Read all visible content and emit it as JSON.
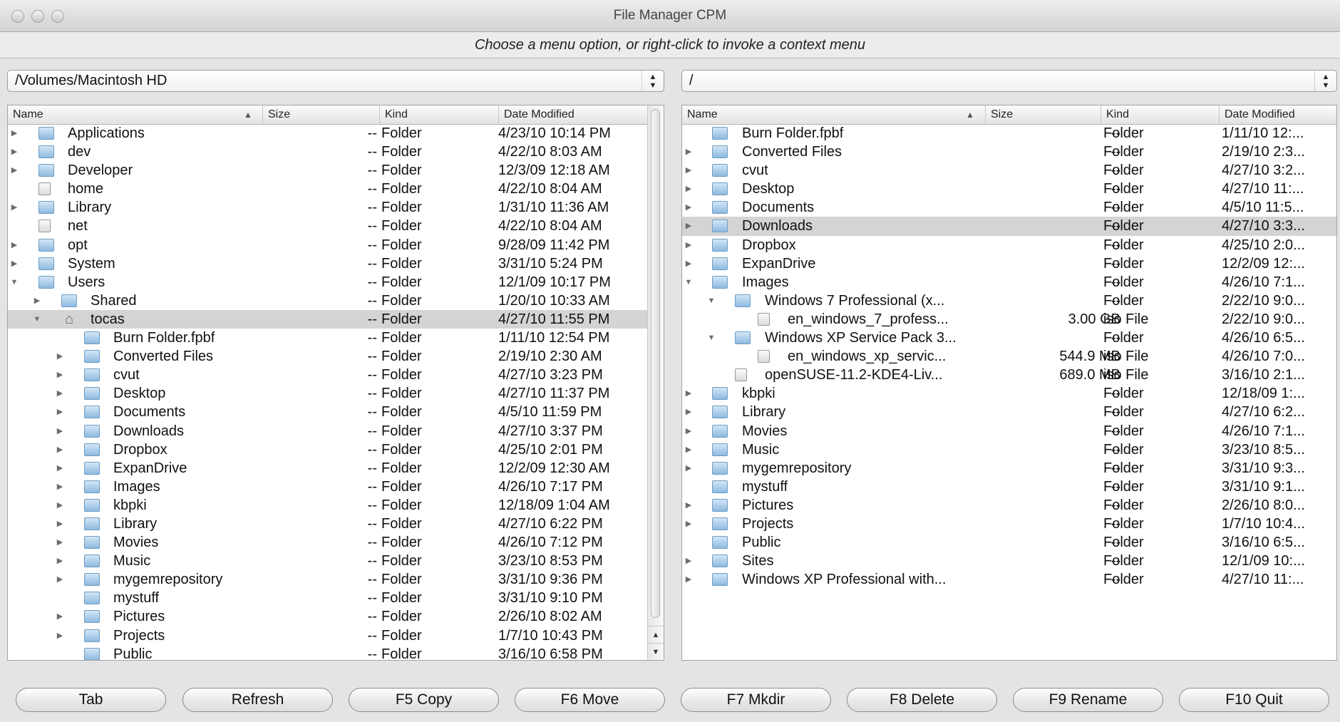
{
  "window": {
    "title": "File Manager CPM",
    "hint": "Choose a menu option, or right-click to invoke a context menu"
  },
  "left": {
    "path": "/Volumes/Macintosh HD",
    "columns": [
      "Name",
      "Size",
      "Kind",
      "Date Modified"
    ],
    "rows": [
      {
        "name": "Applications",
        "size": "--",
        "kind": "Folder",
        "date": "4/23/10 10:14 PM",
        "indent": 0,
        "expander": "closed",
        "icon": "folder"
      },
      {
        "name": "dev",
        "size": "--",
        "kind": "Folder",
        "date": "4/22/10 8:03 AM",
        "indent": 0,
        "expander": "closed",
        "icon": "folder"
      },
      {
        "name": "Developer",
        "size": "--",
        "kind": "Folder",
        "date": "12/3/09 12:18 AM",
        "indent": 0,
        "expander": "closed",
        "icon": "folder"
      },
      {
        "name": "home",
        "size": "--",
        "kind": "Folder",
        "date": "4/22/10 8:04 AM",
        "indent": 0,
        "expander": "none",
        "icon": "generic"
      },
      {
        "name": "Library",
        "size": "--",
        "kind": "Folder",
        "date": "1/31/10 11:36 AM",
        "indent": 0,
        "expander": "closed",
        "icon": "folder"
      },
      {
        "name": "net",
        "size": "--",
        "kind": "Folder",
        "date": "4/22/10 8:04 AM",
        "indent": 0,
        "expander": "none",
        "icon": "generic"
      },
      {
        "name": "opt",
        "size": "--",
        "kind": "Folder",
        "date": "9/28/09 11:42 PM",
        "indent": 0,
        "expander": "closed",
        "icon": "folder"
      },
      {
        "name": "System",
        "size": "--",
        "kind": "Folder",
        "date": "3/31/10 5:24 PM",
        "indent": 0,
        "expander": "closed",
        "icon": "folder"
      },
      {
        "name": "Users",
        "size": "--",
        "kind": "Folder",
        "date": "12/1/09 10:17 PM",
        "indent": 0,
        "expander": "open",
        "icon": "folder"
      },
      {
        "name": "Shared",
        "size": "--",
        "kind": "Folder",
        "date": "1/20/10 10:33 AM",
        "indent": 1,
        "expander": "closed",
        "icon": "folder"
      },
      {
        "name": "tocas",
        "size": "--",
        "kind": "Folder",
        "date": "4/27/10 11:55 PM",
        "indent": 1,
        "expander": "open",
        "icon": "home",
        "selected": true
      },
      {
        "name": "Burn Folder.fpbf",
        "size": "--",
        "kind": "Folder",
        "date": "1/11/10 12:54 PM",
        "indent": 2,
        "expander": "none",
        "icon": "folder"
      },
      {
        "name": "Converted Files",
        "size": "--",
        "kind": "Folder",
        "date": "2/19/10 2:30 AM",
        "indent": 2,
        "expander": "closed",
        "icon": "folder"
      },
      {
        "name": "cvut",
        "size": "--",
        "kind": "Folder",
        "date": "4/27/10 3:23 PM",
        "indent": 2,
        "expander": "closed",
        "icon": "folder"
      },
      {
        "name": "Desktop",
        "size": "--",
        "kind": "Folder",
        "date": "4/27/10 11:37 PM",
        "indent": 2,
        "expander": "closed",
        "icon": "folder"
      },
      {
        "name": "Documents",
        "size": "--",
        "kind": "Folder",
        "date": "4/5/10 11:59 PM",
        "indent": 2,
        "expander": "closed",
        "icon": "folder"
      },
      {
        "name": "Downloads",
        "size": "--",
        "kind": "Folder",
        "date": "4/27/10 3:37 PM",
        "indent": 2,
        "expander": "closed",
        "icon": "folder"
      },
      {
        "name": "Dropbox",
        "size": "--",
        "kind": "Folder",
        "date": "4/25/10 2:01 PM",
        "indent": 2,
        "expander": "closed",
        "icon": "folder"
      },
      {
        "name": "ExpanDrive",
        "size": "--",
        "kind": "Folder",
        "date": "12/2/09 12:30 AM",
        "indent": 2,
        "expander": "closed",
        "icon": "folder"
      },
      {
        "name": "Images",
        "size": "--",
        "kind": "Folder",
        "date": "4/26/10 7:17 PM",
        "indent": 2,
        "expander": "closed",
        "icon": "folder"
      },
      {
        "name": "kbpki",
        "size": "--",
        "kind": "Folder",
        "date": "12/18/09 1:04 AM",
        "indent": 2,
        "expander": "closed",
        "icon": "folder"
      },
      {
        "name": "Library",
        "size": "--",
        "kind": "Folder",
        "date": "4/27/10 6:22 PM",
        "indent": 2,
        "expander": "closed",
        "icon": "folder"
      },
      {
        "name": "Movies",
        "size": "--",
        "kind": "Folder",
        "date": "4/26/10 7:12 PM",
        "indent": 2,
        "expander": "closed",
        "icon": "folder"
      },
      {
        "name": "Music",
        "size": "--",
        "kind": "Folder",
        "date": "3/23/10 8:53 PM",
        "indent": 2,
        "expander": "closed",
        "icon": "folder"
      },
      {
        "name": "mygemrepository",
        "size": "--",
        "kind": "Folder",
        "date": "3/31/10 9:36 PM",
        "indent": 2,
        "expander": "closed",
        "icon": "folder"
      },
      {
        "name": "mystuff",
        "size": "--",
        "kind": "Folder",
        "date": "3/31/10 9:10 PM",
        "indent": 2,
        "expander": "none",
        "icon": "folder"
      },
      {
        "name": "Pictures",
        "size": "--",
        "kind": "Folder",
        "date": "2/26/10 8:02 AM",
        "indent": 2,
        "expander": "closed",
        "icon": "folder"
      },
      {
        "name": "Projects",
        "size": "--",
        "kind": "Folder",
        "date": "1/7/10 10:43 PM",
        "indent": 2,
        "expander": "closed",
        "icon": "folder"
      },
      {
        "name": "Public",
        "size": "--",
        "kind": "Folder",
        "date": "3/16/10 6:58 PM",
        "indent": 2,
        "expander": "none",
        "icon": "folder"
      }
    ]
  },
  "right": {
    "path": "/",
    "columns": [
      "Name",
      "Size",
      "Kind",
      "Date Modified"
    ],
    "rows": [
      {
        "name": "Burn Folder.fpbf",
        "size": "--",
        "kind": "Folder",
        "date": "1/11/10 12:...",
        "indent": 0,
        "expander": "none",
        "icon": "folder"
      },
      {
        "name": "Converted Files",
        "size": "--",
        "kind": "Folder",
        "date": "2/19/10 2:3...",
        "indent": 0,
        "expander": "closed",
        "icon": "folder"
      },
      {
        "name": "cvut",
        "size": "--",
        "kind": "Folder",
        "date": "4/27/10 3:2...",
        "indent": 0,
        "expander": "closed",
        "icon": "folder"
      },
      {
        "name": "Desktop",
        "size": "--",
        "kind": "Folder",
        "date": "4/27/10 11:...",
        "indent": 0,
        "expander": "closed",
        "icon": "folder"
      },
      {
        "name": "Documents",
        "size": "--",
        "kind": "Folder",
        "date": "4/5/10 11:5...",
        "indent": 0,
        "expander": "closed",
        "icon": "folder"
      },
      {
        "name": "Downloads",
        "size": "--",
        "kind": "Folder",
        "date": "4/27/10 3:3...",
        "indent": 0,
        "expander": "closed",
        "icon": "folder",
        "selected": true
      },
      {
        "name": "Dropbox",
        "size": "--",
        "kind": "Folder",
        "date": "4/25/10 2:0...",
        "indent": 0,
        "expander": "closed",
        "icon": "folder"
      },
      {
        "name": "ExpanDrive",
        "size": "--",
        "kind": "Folder",
        "date": "12/2/09 12:...",
        "indent": 0,
        "expander": "closed",
        "icon": "folder"
      },
      {
        "name": "Images",
        "size": "--",
        "kind": "Folder",
        "date": "4/26/10 7:1...",
        "indent": 0,
        "expander": "open",
        "icon": "folder"
      },
      {
        "name": "Windows 7 Professional (x...",
        "size": "--",
        "kind": "Folder",
        "date": "2/22/10 9:0...",
        "indent": 1,
        "expander": "open",
        "icon": "folder"
      },
      {
        "name": "en_windows_7_profess...",
        "size": "3.00 GB",
        "kind": "iso File",
        "date": "2/22/10 9:0...",
        "indent": 2,
        "expander": "none",
        "icon": "generic"
      },
      {
        "name": "Windows XP Service Pack 3...",
        "size": "--",
        "kind": "Folder",
        "date": "4/26/10 6:5...",
        "indent": 1,
        "expander": "open",
        "icon": "folder"
      },
      {
        "name": "en_windows_xp_servic...",
        "size": "544.9 MB",
        "kind": "iso File",
        "date": "4/26/10 7:0...",
        "indent": 2,
        "expander": "none",
        "icon": "generic"
      },
      {
        "name": "openSUSE-11.2-KDE4-Liv...",
        "size": "689.0 MB",
        "kind": "iso File",
        "date": "3/16/10 2:1...",
        "indent": 1,
        "expander": "none",
        "icon": "generic"
      },
      {
        "name": "kbpki",
        "size": "--",
        "kind": "Folder",
        "date": "12/18/09 1:...",
        "indent": 0,
        "expander": "closed",
        "icon": "folder"
      },
      {
        "name": "Library",
        "size": "--",
        "kind": "Folder",
        "date": "4/27/10 6:2...",
        "indent": 0,
        "expander": "closed",
        "icon": "folder"
      },
      {
        "name": "Movies",
        "size": "--",
        "kind": "Folder",
        "date": "4/26/10 7:1...",
        "indent": 0,
        "expander": "closed",
        "icon": "folder"
      },
      {
        "name": "Music",
        "size": "--",
        "kind": "Folder",
        "date": "3/23/10 8:5...",
        "indent": 0,
        "expander": "closed",
        "icon": "folder"
      },
      {
        "name": "mygemrepository",
        "size": "--",
        "kind": "Folder",
        "date": "3/31/10 9:3...",
        "indent": 0,
        "expander": "closed",
        "icon": "folder"
      },
      {
        "name": "mystuff",
        "size": "--",
        "kind": "Folder",
        "date": "3/31/10 9:1...",
        "indent": 0,
        "expander": "none",
        "icon": "folder"
      },
      {
        "name": "Pictures",
        "size": "--",
        "kind": "Folder",
        "date": "2/26/10 8:0...",
        "indent": 0,
        "expander": "closed",
        "icon": "folder"
      },
      {
        "name": "Projects",
        "size": "--",
        "kind": "Folder",
        "date": "1/7/10 10:4...",
        "indent": 0,
        "expander": "closed",
        "icon": "folder"
      },
      {
        "name": "Public",
        "size": "--",
        "kind": "Folder",
        "date": "3/16/10 6:5...",
        "indent": 0,
        "expander": "none",
        "icon": "folder"
      },
      {
        "name": "Sites",
        "size": "--",
        "kind": "Folder",
        "date": "12/1/09 10:...",
        "indent": 0,
        "expander": "closed",
        "icon": "folder"
      },
      {
        "name": "Windows XP Professional with...",
        "size": "--",
        "kind": "Folder",
        "date": "4/27/10 11:...",
        "indent": 0,
        "expander": "closed",
        "icon": "folder"
      }
    ]
  },
  "buttons": [
    "Tab",
    "Refresh",
    "F5 Copy",
    "F6 Move",
    "F7 Mkdir",
    "F8 Delete",
    "F9 Rename",
    "F10 Quit"
  ],
  "colors": {
    "selection": "#d4d4d4",
    "folder": "#8ebae0",
    "desktop": "#5b8fb0"
  }
}
